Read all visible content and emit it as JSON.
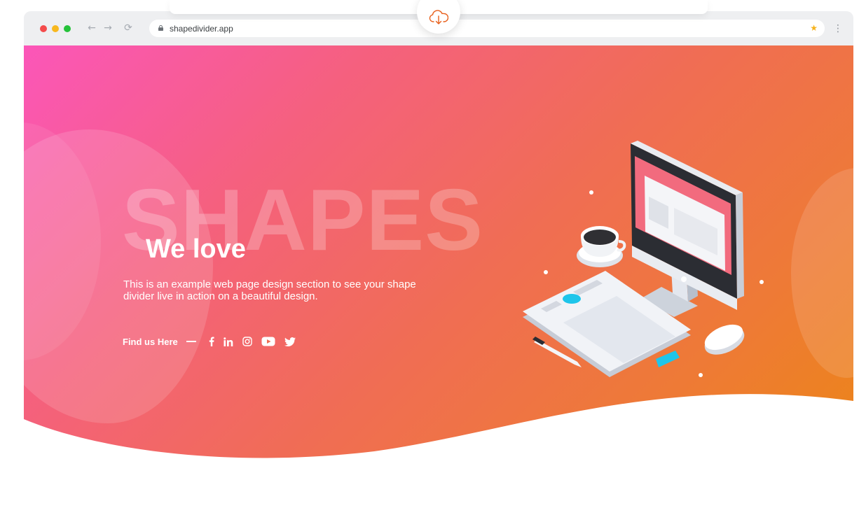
{
  "browser": {
    "url": "shapedivider.app",
    "nav": {
      "back_icon": "←",
      "forward_icon": "→",
      "reload_icon": "⟳"
    },
    "menu_icon": "⋮",
    "bookmark_icon": "★",
    "traffic_lights": [
      "#f44b4b",
      "#f8b81e",
      "#25c23a"
    ]
  },
  "hero": {
    "background_word": "SHAPES",
    "headline": "We love",
    "description": "This is an example web page design section to see your shape divider live in action on a beautiful design.",
    "find_label": "Find us Here",
    "socials": [
      "facebook-icon",
      "linkedin-icon",
      "instagram-icon",
      "youtube-icon",
      "twitter-icon"
    ],
    "colors": {
      "gradient_start": "#fb56b9",
      "gradient_end": "#ec8518",
      "accent": "#e8601c"
    }
  }
}
